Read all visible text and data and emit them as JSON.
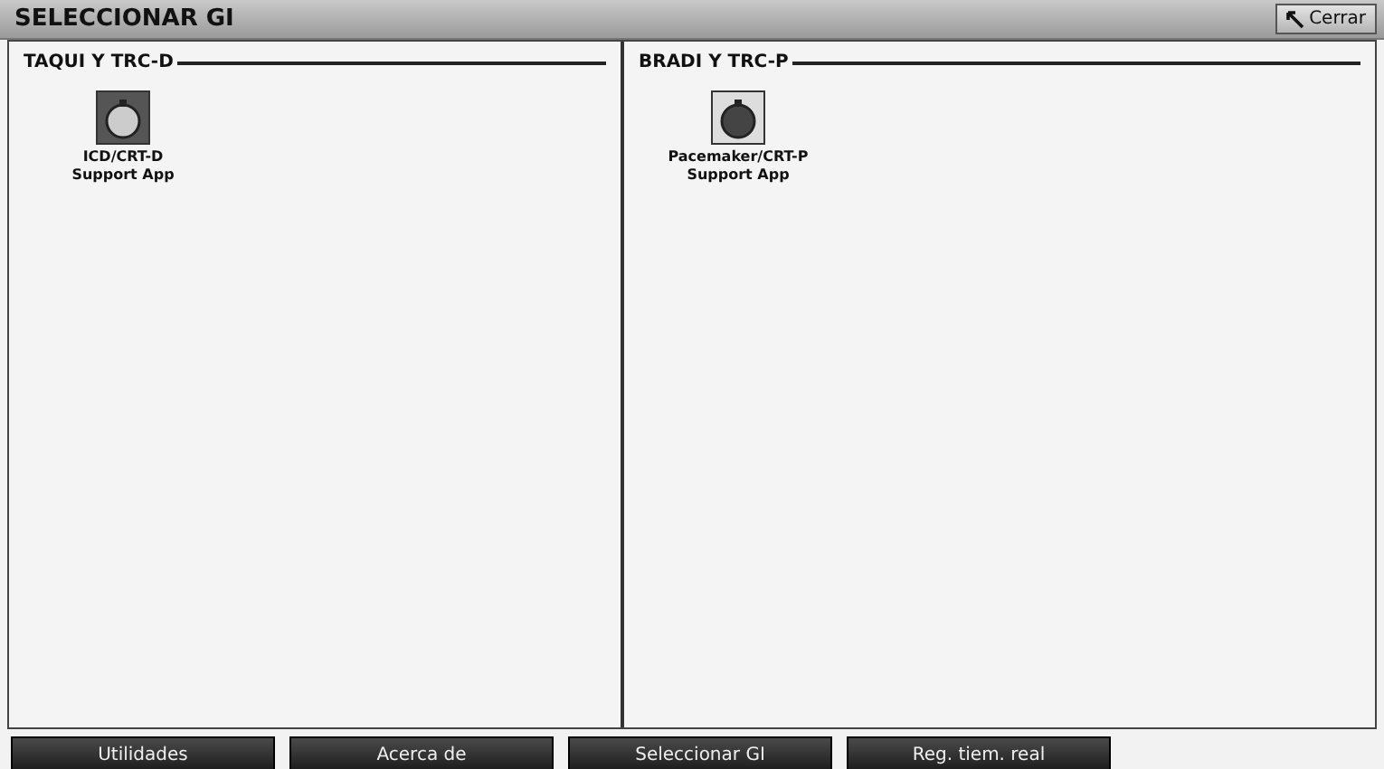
{
  "window": {
    "title": "SELECCIONAR GI",
    "close_button": "Cerrar"
  },
  "groups": [
    {
      "title": "TAQUI Y TRC-D",
      "apps": [
        {
          "label": "ICD/CRT-D Support App",
          "selected": true
        }
      ]
    },
    {
      "title": "BRADI Y TRC-P",
      "apps": [
        {
          "label": "Pacemaker/CRT-P Support App",
          "selected": false
        }
      ]
    }
  ],
  "bottom_buttons": [
    "Utilidades",
    "Acerca de",
    "Seleccionar GI",
    "Reg. tiem. real"
  ]
}
